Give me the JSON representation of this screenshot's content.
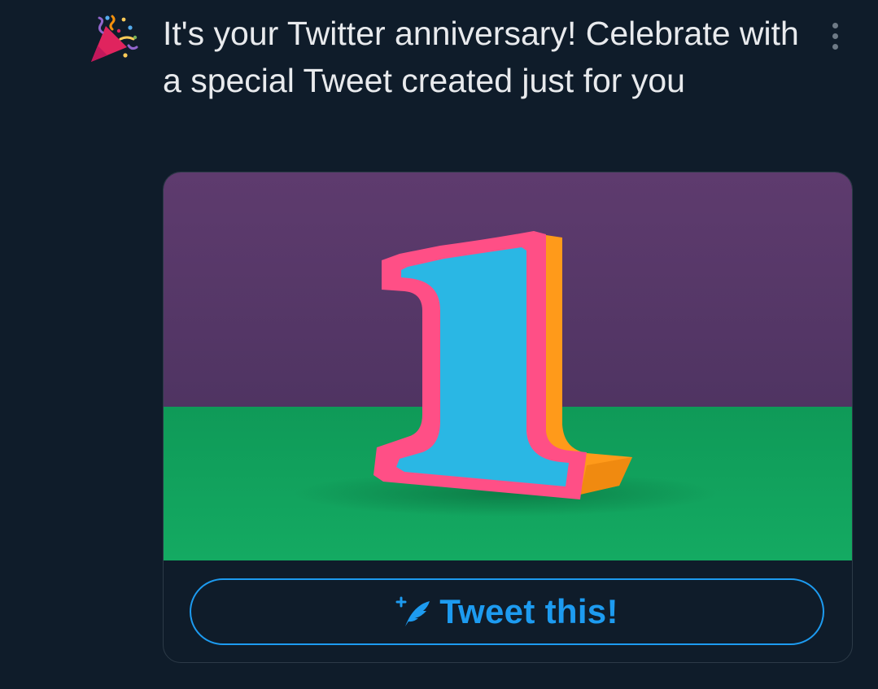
{
  "notification": {
    "icon": "party-popper-icon",
    "message": "It's your Twitter anniversary! Celebrate with a special Tweet created just for you",
    "menu_icon": "more-vertical-icon"
  },
  "card": {
    "image_subject": "1",
    "button": {
      "icon": "compose-tweet-icon",
      "label": "Tweet this!"
    }
  },
  "colors": {
    "background": "#0f1c2a",
    "accent": "#1d9bf0",
    "text": "#e8eaed",
    "image_wall": "#5a3a6a",
    "image_floor": "#13a25e",
    "numeral_face": "#29b6e6",
    "numeral_rim": "#ff4f86",
    "numeral_side": "#ff9a1a"
  }
}
